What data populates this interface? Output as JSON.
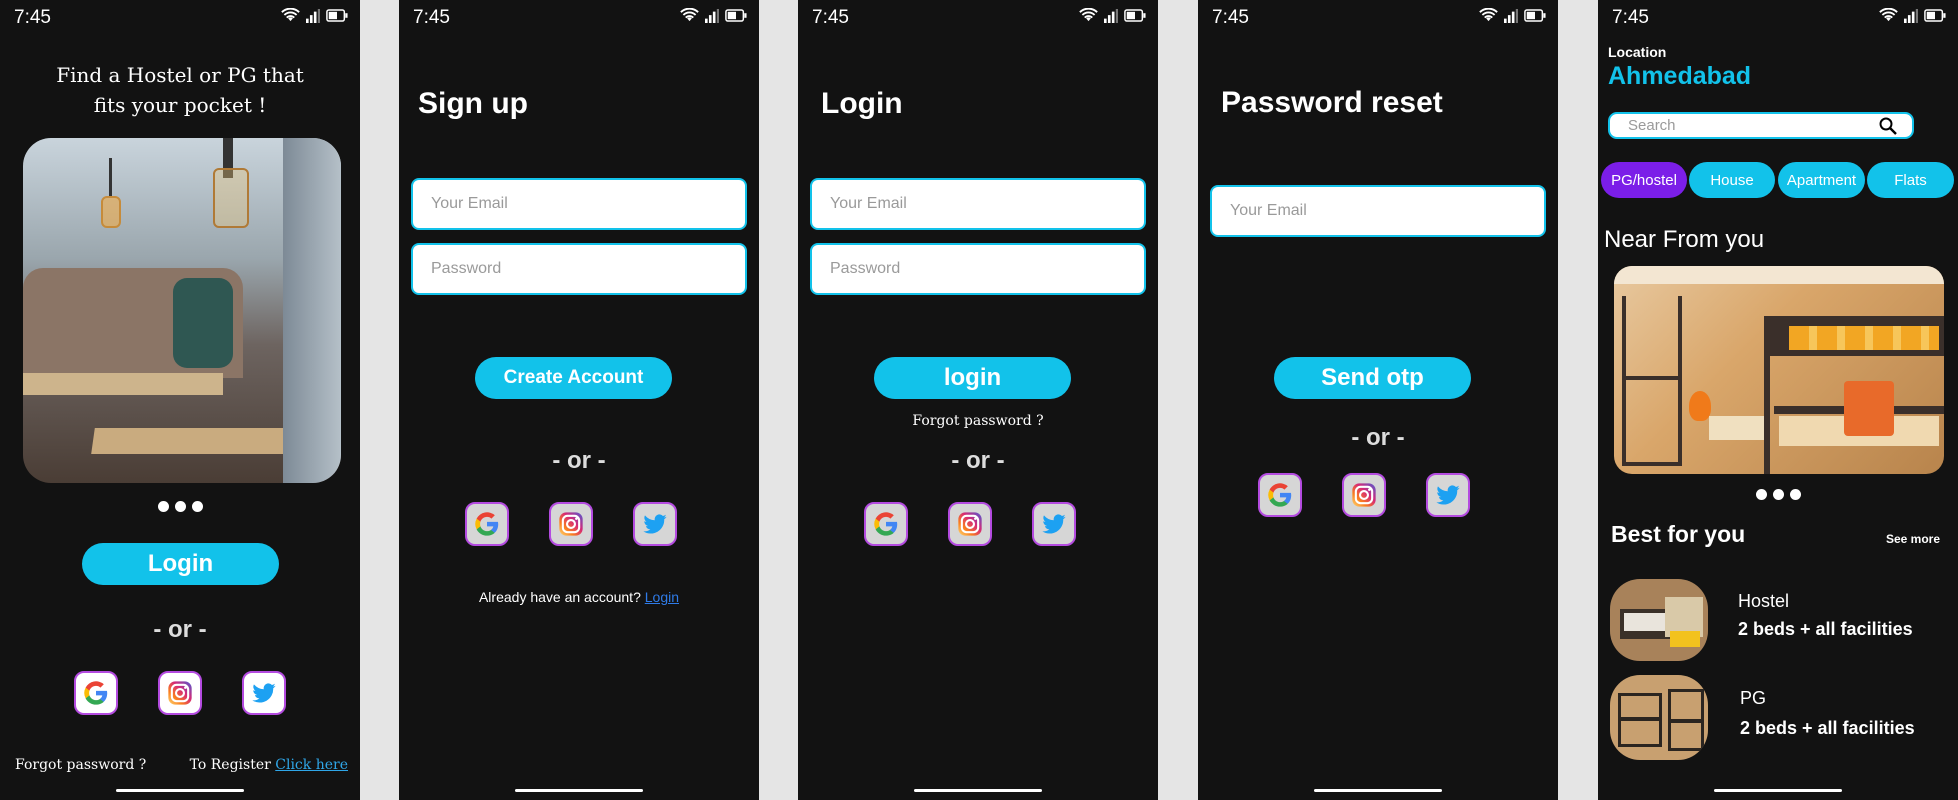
{
  "status": {
    "time": "7:45"
  },
  "welcome": {
    "tagline": "Find a Hostel or PG that fits your pocket !",
    "login_label": "Login",
    "or_label": "- or -",
    "forgot_label": "Forgot password ?",
    "register_prefix": "To Register",
    "register_link": "Click here"
  },
  "signup": {
    "title": "Sign up",
    "email_placeholder": "Your Email",
    "password_placeholder": "Password",
    "create_label": "Create Account",
    "or_label": "- or -",
    "have_account": "Already have an account?",
    "login_link": "Login"
  },
  "login": {
    "title": "Login",
    "email_placeholder": "Your Email",
    "password_placeholder": "Password",
    "login_label": "login",
    "forgot_label": "Forgot password ?",
    "or_label": "- or -"
  },
  "reset": {
    "title": "Password reset",
    "email_placeholder": "Your Email",
    "send_label": "Send otp",
    "or_label": "- or -"
  },
  "home": {
    "location_label": "Location",
    "city": "Ahmedabad",
    "search_placeholder": "Search",
    "chips": [
      "PG/hostel",
      "House",
      "Apartment",
      "Flats"
    ],
    "near_title": "Near From you",
    "best_title": "Best for you",
    "see_more": "See more",
    "listings": [
      {
        "title": "Hostel",
        "subtitle": "2 beds + all facilities"
      },
      {
        "title": "PG",
        "subtitle": "2 beds + all facilities"
      }
    ]
  },
  "colors": {
    "accent": "#12c2ea",
    "chip_active": "#7b1ee8",
    "background": "#121212"
  }
}
